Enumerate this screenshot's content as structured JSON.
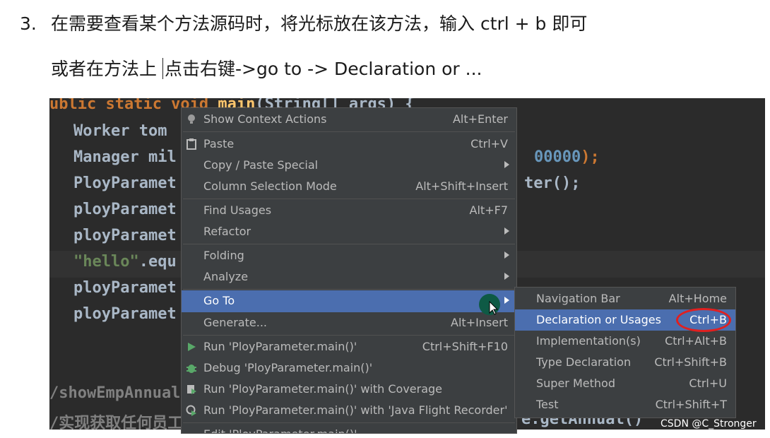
{
  "doc": {
    "line1_num": "3.",
    "line1_text": "在需要查看某个方法源码时，将光标放在该方法，输入 ctrl + b 即可",
    "line2_before_caret": "或者在方法上",
    "line2_after_caret": "点击右键->go to -> Declaration or ..."
  },
  "code": {
    "l1_kw": "ublic static void",
    "l1_fn": "main",
    "l1_rest": "(String[] args) {",
    "l2": "Worker tom",
    "l3": "Manager mil",
    "l3_tail_num": "00000",
    "l3_tail": ");",
    "l4": "PloyParamet",
    "l4_tail": "ter();",
    "l5": "ployParamet",
    "l6": "ployParamet",
    "l7_str": "\"hello\"",
    "l7_rest": ".equ",
    "l8": "ployParamet",
    "l9": "ployParamet",
    "c1": "/showEmpAnnual",
    "c2": "/实现获取任何员工",
    "c2_tail": "e.getAnnual()"
  },
  "context_menu": {
    "items": [
      {
        "label": "Show Context Actions",
        "shortcut": "Alt+Enter",
        "icon": "bulb-icon"
      },
      {
        "label": "Paste",
        "shortcut": "Ctrl+V",
        "icon": "clipboard-icon"
      },
      {
        "label": "Copy / Paste Special",
        "shortcut": ""
      },
      {
        "label": "Column Selection Mode",
        "shortcut": "Alt+Shift+Insert"
      },
      {
        "label": "Find Usages",
        "shortcut": "Alt+F7"
      },
      {
        "label": "Refactor",
        "shortcut": ""
      },
      {
        "label": "Folding",
        "shortcut": ""
      },
      {
        "label": "Analyze",
        "shortcut": ""
      },
      {
        "label": "Go To",
        "shortcut": ""
      },
      {
        "label": "Generate...",
        "shortcut": "Alt+Insert"
      },
      {
        "label": "Run 'PloyParameter.main()'",
        "shortcut": "Ctrl+Shift+F10",
        "icon": "run-icon"
      },
      {
        "label": "Debug 'PloyParameter.main()'",
        "shortcut": "",
        "icon": "debug-icon"
      },
      {
        "label": "Run 'PloyParameter.main()' with Coverage",
        "shortcut": "",
        "icon": "coverage-icon"
      },
      {
        "label": "Run 'PloyParameter.main()' with 'Java Flight Recorder'",
        "shortcut": "",
        "icon": "flight-recorder-icon"
      },
      {
        "label": "Edit 'PloyParameter.main()'...",
        "shortcut": ""
      }
    ]
  },
  "submenu": {
    "items": [
      {
        "label": "Navigation Bar",
        "shortcut": "Alt+Home"
      },
      {
        "label": "Declaration or Usages",
        "shortcut": "Ctrl+B"
      },
      {
        "label": "Implementation(s)",
        "shortcut": "Ctrl+Alt+B"
      },
      {
        "label": "Type Declaration",
        "shortcut": "Ctrl+Shift+B"
      },
      {
        "label": "Super Method",
        "shortcut": "Ctrl+U"
      },
      {
        "label": "Test",
        "shortcut": "Ctrl+Shift+T"
      }
    ]
  },
  "watermark": "CSDN @C_Stronger",
  "colors": {
    "highlight": "#4b6eaf",
    "menu_bg": "#3c3f41",
    "editor_bg": "#2b2b2b",
    "annotation": "#e02020"
  }
}
